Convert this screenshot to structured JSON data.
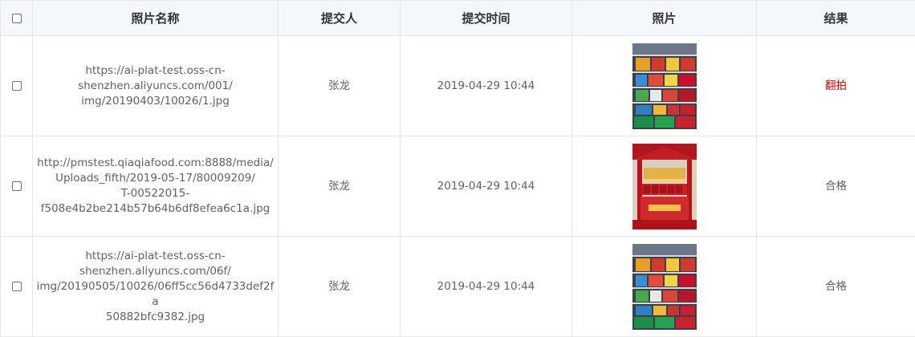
{
  "header": {
    "name": "照片名称",
    "submitter": "提交人",
    "time": "提交时间",
    "photo": "照片",
    "result": "结果"
  },
  "rows": [
    {
      "name_lines": [
        "https://ai-plat-test.oss-cn-",
        "shenzhen.aliyuncs.com/001/",
        "img/20190403/10026/1.jpg"
      ],
      "submitter": "张龙",
      "time": "2019-04-29 10:44",
      "photo_icon": "store-shelf-photo",
      "result": "翻拍",
      "result_color": "#cc0000"
    },
    {
      "name_lines": [
        "http://pmstest.qiaqiafood.com:8888/media/",
        "Uploads_fifth/2019-05-17/80009209/",
        "T-00522015-",
        "f508e4b2be214b57b64b6df8efea6c1a.jpg"
      ],
      "submitter": "张龙",
      "time": "2019-04-29 10:44",
      "photo_icon": "red-display-stand-photo",
      "result": "合格",
      "result_color": "#606266"
    },
    {
      "name_lines": [
        "https://ai-plat-test.oss-cn-",
        "shenzhen.aliyuncs.com/06f/",
        "img/20190505/10026/06ff5cc56d4733def2fa",
        "50882bfc9382.jpg"
      ],
      "submitter": "张龙",
      "time": "2019-04-29 10:44",
      "photo_icon": "store-shelf-photo",
      "result": "合格",
      "result_color": "#606266"
    }
  ]
}
